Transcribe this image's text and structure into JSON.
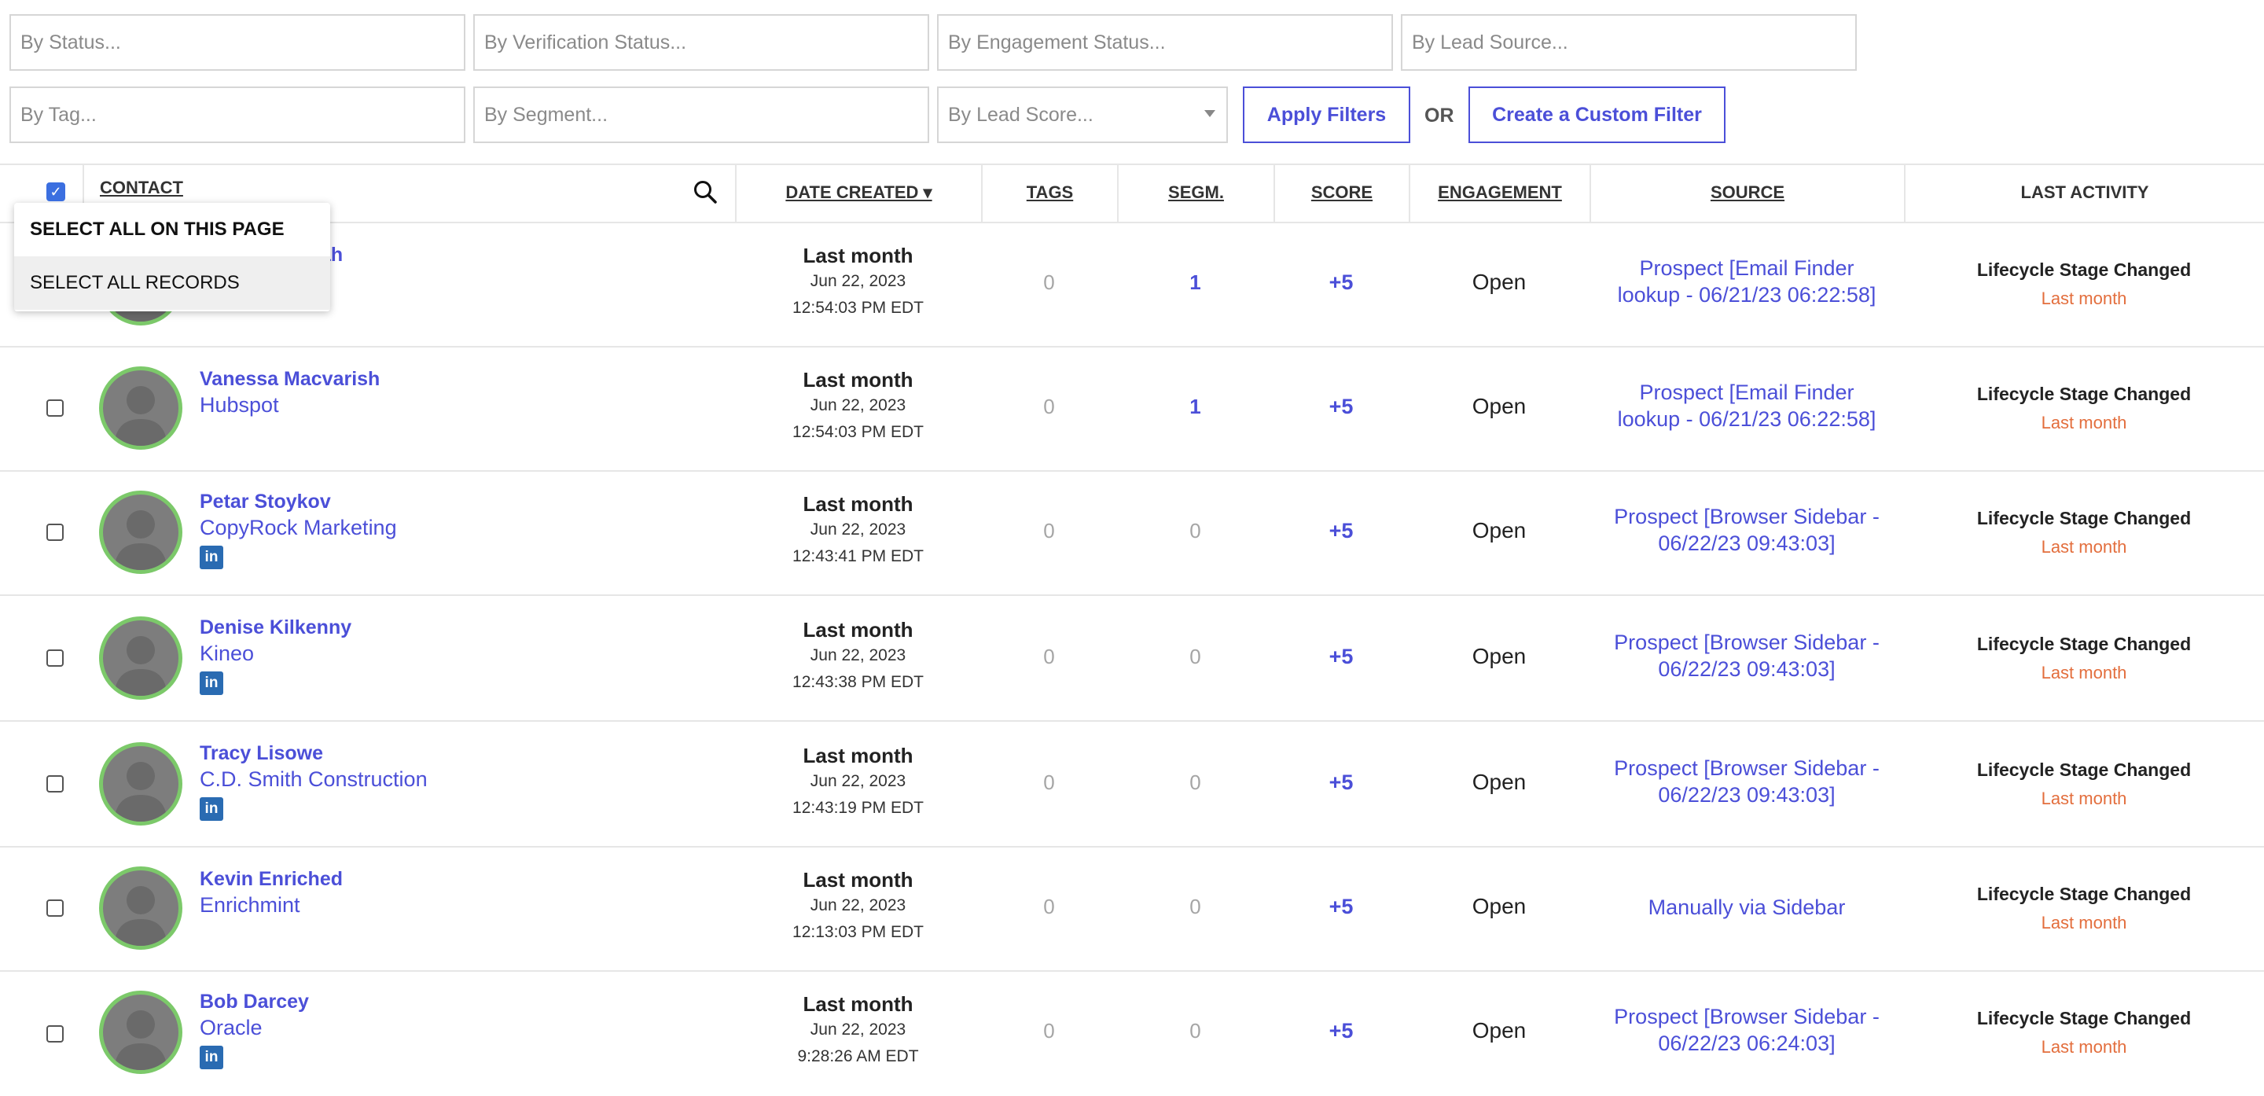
{
  "filters": {
    "status_placeholder": "By Status...",
    "verification_placeholder": "By Verification Status...",
    "engagement_placeholder": "By Engagement Status...",
    "lead_source_placeholder": "By Lead Source...",
    "tag_placeholder": "By Tag...",
    "segment_placeholder": "By Segment...",
    "lead_score_value": "By Lead Score...",
    "apply_label": "Apply Filters",
    "or_label": "OR",
    "custom_filter_label": "Create a Custom Filter"
  },
  "table": {
    "headers": {
      "contact": "CONTACT",
      "date_created": "DATE CREATED ▾",
      "tags": "TAGS",
      "segments": "SEGM.",
      "score": "SCORE",
      "engagement": "ENGAGEMENT",
      "source": "SOURCE",
      "last_activity": "LAST ACTIVITY"
    },
    "select_menu": {
      "select_page": "SELECT ALL ON THIS PAGE",
      "select_all": "SELECT ALL RECORDS"
    },
    "partial_name_fragment": "ah",
    "rows": [
      {
        "name": "",
        "company": "",
        "linkedin": false,
        "relative": "Last month",
        "date": "Jun 22, 2023",
        "time": "12:54:03 PM EDT",
        "tags": "0",
        "segments": "1",
        "score": "+5",
        "engagement": "Open",
        "source_line1": "Prospect [Email Finder",
        "source_line2": "lookup - 06/21/23 06:22:58]",
        "activity": "Lifecycle Stage Changed",
        "activity_time": "Last month"
      },
      {
        "name": "Vanessa Macvarish",
        "company": "Hubspot",
        "linkedin": false,
        "relative": "Last month",
        "date": "Jun 22, 2023",
        "time": "12:54:03 PM EDT",
        "tags": "0",
        "segments": "1",
        "score": "+5",
        "engagement": "Open",
        "source_line1": "Prospect [Email Finder",
        "source_line2": "lookup - 06/21/23 06:22:58]",
        "activity": "Lifecycle Stage Changed",
        "activity_time": "Last month"
      },
      {
        "name": "Petar Stoykov",
        "company": "CopyRock Marketing",
        "linkedin": true,
        "relative": "Last month",
        "date": "Jun 22, 2023",
        "time": "12:43:41 PM EDT",
        "tags": "0",
        "segments": "0",
        "score": "+5",
        "engagement": "Open",
        "source_line1": "Prospect [Browser Sidebar -",
        "source_line2": "06/22/23 09:43:03]",
        "activity": "Lifecycle Stage Changed",
        "activity_time": "Last month"
      },
      {
        "name": "Denise Kilkenny",
        "company": "Kineo",
        "linkedin": true,
        "relative": "Last month",
        "date": "Jun 22, 2023",
        "time": "12:43:38 PM EDT",
        "tags": "0",
        "segments": "0",
        "score": "+5",
        "engagement": "Open",
        "source_line1": "Prospect [Browser Sidebar -",
        "source_line2": "06/22/23 09:43:03]",
        "activity": "Lifecycle Stage Changed",
        "activity_time": "Last month"
      },
      {
        "name": "Tracy Lisowe",
        "company": "C.D. Smith Construction",
        "linkedin": true,
        "relative": "Last month",
        "date": "Jun 22, 2023",
        "time": "12:43:19 PM EDT",
        "tags": "0",
        "segments": "0",
        "score": "+5",
        "engagement": "Open",
        "source_line1": "Prospect [Browser Sidebar -",
        "source_line2": "06/22/23 09:43:03]",
        "activity": "Lifecycle Stage Changed",
        "activity_time": "Last month"
      },
      {
        "name": "Kevin Enriched",
        "company": "Enrichmint",
        "linkedin": false,
        "relative": "Last month",
        "date": "Jun 22, 2023",
        "time": "12:13:03 PM EDT",
        "tags": "0",
        "segments": "0",
        "score": "+5",
        "engagement": "Open",
        "source_line1": "Manually via Sidebar",
        "source_line2": "",
        "activity": "Lifecycle Stage Changed",
        "activity_time": "Last month"
      },
      {
        "name": "Bob Darcey",
        "company": "Oracle",
        "linkedin": true,
        "relative": "Last month",
        "date": "Jun 22, 2023",
        "time": "9:28:26 AM EDT",
        "tags": "0",
        "segments": "0",
        "score": "+5",
        "engagement": "Open",
        "source_line1": "Prospect [Browser Sidebar -",
        "source_line2": "06/22/23 06:24:03]",
        "activity": "Lifecycle Stage Changed",
        "activity_time": "Last month"
      }
    ]
  },
  "icons": {
    "search": "search-icon",
    "linkedin": "linkedin-icon",
    "avatar": "person-silhouette-icon",
    "caret": "chevron-down-icon"
  },
  "colors": {
    "accent": "#4b4fd8",
    "avatar_ring": "#7cc96a",
    "activity_time": "#e36e3d",
    "linkedin": "#2a6bb2"
  }
}
